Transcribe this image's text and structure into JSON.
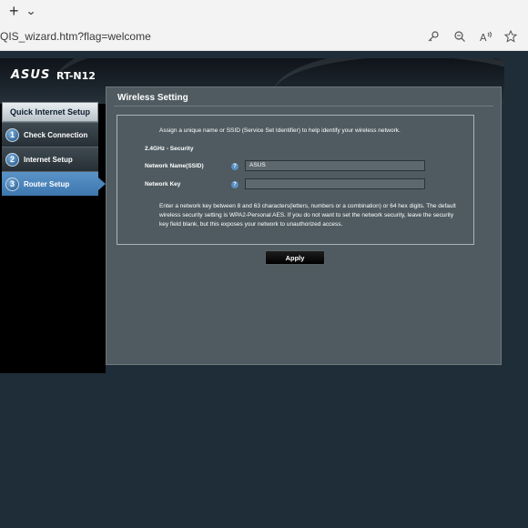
{
  "browser": {
    "url": "QIS_wizard.htm?flag=welcome",
    "icons": [
      "new-tab-plus-icon",
      "tab-list-chevron-icon",
      "key-icon",
      "zoom-icon",
      "read-aloud-icon",
      "favorites-star-icon"
    ]
  },
  "header": {
    "brand": "ASUS",
    "model": "RT-N12"
  },
  "sidebar": {
    "title": "Quick Internet Setup",
    "items": [
      {
        "num": "1",
        "label": "Check Connection"
      },
      {
        "num": "2",
        "label": "Internet Setup"
      },
      {
        "num": "3",
        "label": "Router Setup"
      }
    ]
  },
  "content": {
    "title": "Wireless Setting",
    "intro": "Assign a unique name or SSID (Service Set Identifier) to help identify your wireless network.",
    "section": "2.4GHz - Security",
    "ssid_label": "Network Name(SSID)",
    "ssid_value": "ASUS",
    "key_label": "Network Key",
    "key_value": "",
    "help": "?",
    "note": "Enter a network key between 8 and 63 characters(letters, numbers or a combination) or 64 hex digits. The default wireless security setting is WPA2-Personal AES. If you do not want to set the network security, leave the security key field blank, but this exposes your network to unauthorized access.",
    "apply_label": "Apply"
  },
  "colors": {
    "accent": "#4a85bb",
    "page_bg": "#1f2d38",
    "panel_bg": "#4f5b61"
  }
}
